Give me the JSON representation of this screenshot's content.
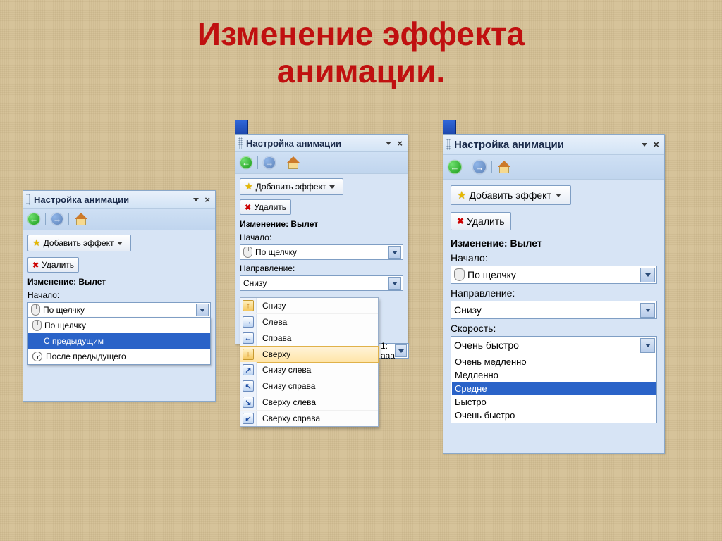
{
  "title_line1": "Изменение эффекта",
  "title_line2": "анимации.",
  "panel_title": "Настройка анимации",
  "add_effect": "Добавить эффект",
  "delete": "Удалить",
  "change_label": "Изменение: Вылет",
  "start_label": "Начало:",
  "direction_label": "Направление:",
  "speed_label": "Скорость:",
  "start_value": "По щелчку",
  "direction_value": "Снизу",
  "speed_value": "Очень быстро",
  "list_item_hint": "1: aaa",
  "start_options": {
    "onclick": "По щелчку",
    "withprev": "С предыдущим",
    "afterprev": "После предыдущего"
  },
  "direction_options": {
    "bottom": "Снизу",
    "left": "Слева",
    "right": "Справа",
    "top": "Сверху",
    "bottomleft": "Снизу слева",
    "bottomright": "Снизу справа",
    "topleft": "Сверху слева",
    "topright": "Сверху справа"
  },
  "speed_options": {
    "veryslow": "Очень медленно",
    "slow": "Медленно",
    "medium": "Средне",
    "fast": "Быстро",
    "veryfast": "Очень быстро"
  },
  "arrows": {
    "up": "↑",
    "right": "→",
    "left": "←",
    "down": "↓",
    "upright": "↗",
    "upleft": "↖",
    "downright": "↘",
    "downleft": "↙"
  }
}
